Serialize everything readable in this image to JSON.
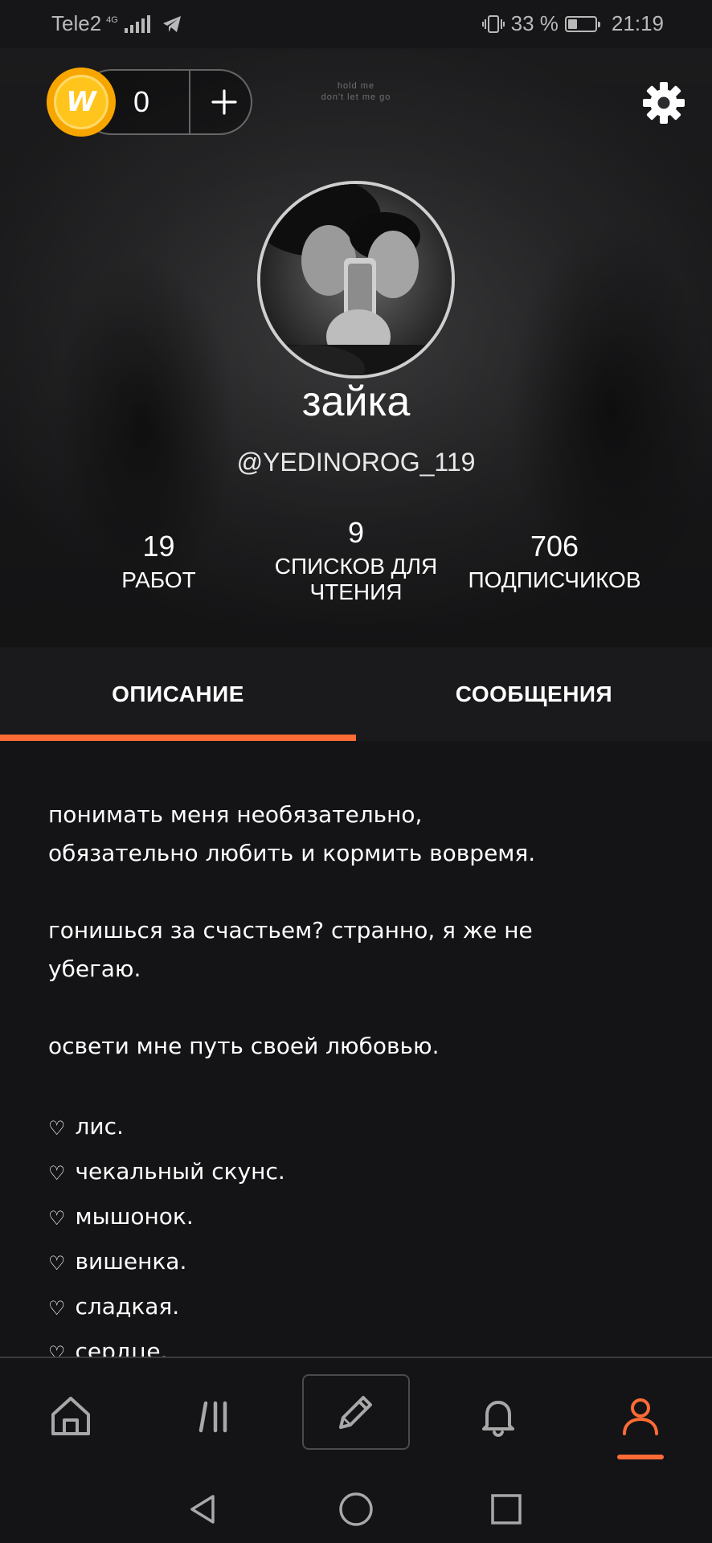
{
  "status_bar": {
    "carrier": "Tele2",
    "network": "4G",
    "battery_percent": "33 %",
    "battery_level": 0.33,
    "time": "21:19",
    "icons": [
      "telegram-icon",
      "vibrate-icon",
      "battery-icon",
      "signal-icon"
    ]
  },
  "header": {
    "background_caption": [
      "hold me",
      "don't let me go"
    ],
    "coins": {
      "count": "0",
      "coin_letter": "W"
    },
    "username": "зайка",
    "handle": "@YEDINOROG_119",
    "stats": {
      "works": {
        "value": "19",
        "label": "РАБОТ"
      },
      "reading_lists": {
        "value": "9",
        "label_line1": "СПИСКОВ ДЛЯ",
        "label_line2": "ЧТЕНИЯ"
      },
      "followers": {
        "value": "706",
        "label": "ПОДПИСЧИКОВ"
      }
    }
  },
  "tabs": {
    "description": "ОПИСАНИЕ",
    "messages": "СООБЩЕНИЯ",
    "active": "description"
  },
  "description": {
    "lines": [
      "понимать меня необязательно,",
      "обязательно любить и кормить вовремя.",
      "",
      "гонишься за счастьем? странно, я же не",
      "убегаю.",
      "",
      "освети мне путь своей любовью."
    ],
    "heart_glyph": "♡",
    "nicknames": [
      "лис.",
      "чекальный скунс.",
      "мышонок.",
      "вишенка.",
      "сладкая.",
      "сердце."
    ]
  },
  "bottom_nav": {
    "items": [
      "home-icon",
      "library-icon",
      "write-icon",
      "notifications-icon",
      "profile-icon"
    ],
    "active": "profile-icon"
  },
  "colors": {
    "accent": "#ff6b35",
    "coin": "#ffc51d",
    "background": "#141416",
    "tabs_background": "#1a1a1c"
  }
}
